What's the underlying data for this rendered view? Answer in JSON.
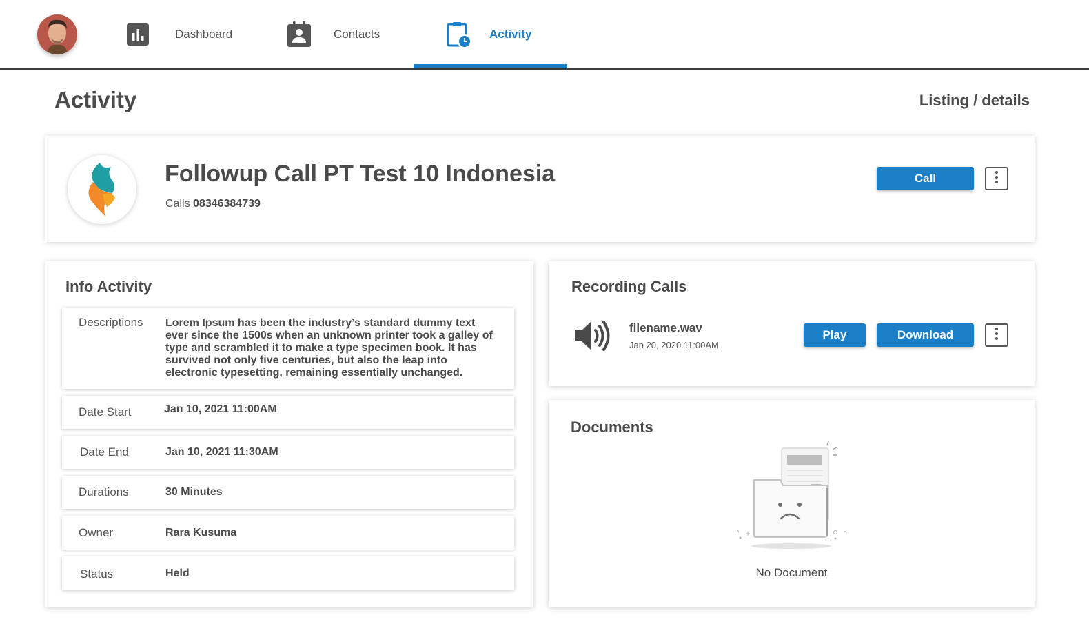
{
  "nav": {
    "items": [
      {
        "label": "Dashboard",
        "icon": "bar-chart-icon"
      },
      {
        "label": "Contacts",
        "icon": "contact-book-icon"
      },
      {
        "label": "Activity",
        "icon": "clipboard-clock-icon",
        "active": true
      }
    ],
    "accent_color": "#1b7fc7"
  },
  "page": {
    "title": "Activity",
    "breadcrumb": "Listing / details"
  },
  "activity": {
    "title": "Followup Call PT Test 10 Indonesia",
    "type_label": "Calls",
    "phone": "08346384739",
    "call_button": "Call"
  },
  "info": {
    "title": "Info Activity",
    "rows": [
      {
        "label": "Descriptions",
        "value": "Lorem Ipsum has been the industry’s standard dummy text ever since the 1500s when an unknown printer took a galley of type and scrambled it to make a type specimen book. It has survived not only five centuries, but also the leap into electronic typesetting, remaining essentially unchanged."
      },
      {
        "label": "Date Start",
        "value": "Jan 10, 2021 11:00AM"
      },
      {
        "label": "Date End",
        "value": "Jan 10, 2021 11:30AM"
      },
      {
        "label": "Durations",
        "value": "30 Minutes"
      },
      {
        "label": "Owner",
        "value": "Rara Kusuma"
      },
      {
        "label": "Status",
        "value": "Held"
      }
    ]
  },
  "recording": {
    "title": "Recording Calls",
    "file_name": "filename.wav",
    "file_date": "Jan 20, 2020 11:00AM",
    "play_button": "Play",
    "download_button": "Download"
  },
  "documents": {
    "title": "Documents",
    "empty_text": "No Document"
  }
}
